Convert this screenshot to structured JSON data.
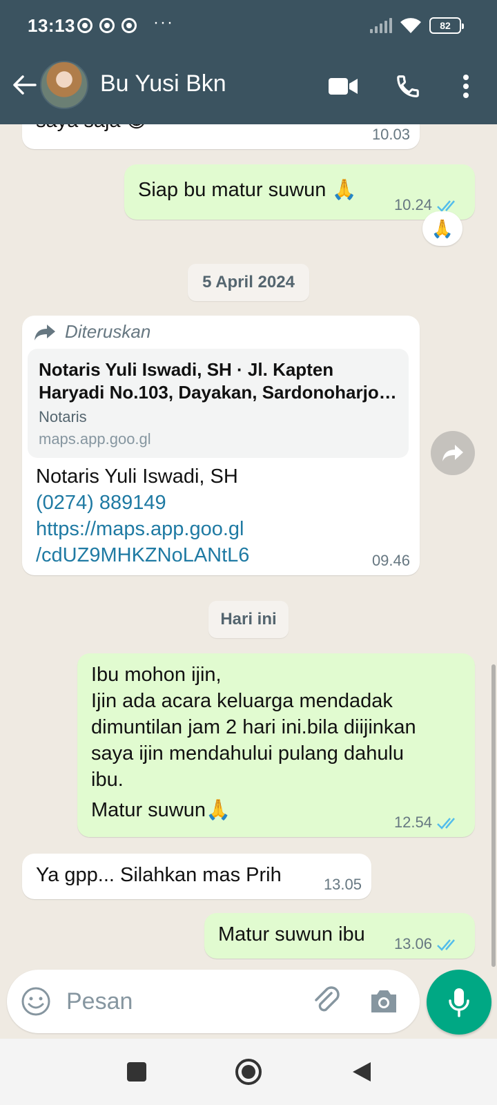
{
  "status": {
    "time": "13:13",
    "ellipsis": "···",
    "battery": "82"
  },
  "header": {
    "contact_name": "Bu Yusi Bkn"
  },
  "messages": {
    "m1": {
      "text": "saya saja 😁",
      "time": "10.03"
    },
    "m2": {
      "text": "Siap bu matur suwun 🙏",
      "time": "10.24",
      "reaction": "🙏"
    },
    "date1": "5 April 2024",
    "m3": {
      "forwarded_label": "Diteruskan",
      "link_title_1": "Notaris Yuli Iswadi, SH · Jl. Kapten",
      "link_title_2": "Haryadi No.103, Dayakan, Sardonoharjo,…",
      "link_category": "Notaris",
      "link_domain": "maps.app.goo.gl",
      "line1": "Notaris Yuli Iswadi, SH",
      "phone": "(0274) 889149",
      "url_1": "https://maps.app.goo.gl",
      "url_2": "/cdUZ9MHKZNoLANtL6",
      "time": "09.46"
    },
    "date2": "Hari ini",
    "m4": {
      "line1": "Ibu mohon ijin,",
      "line2": "Ijin ada acara keluarga mendadak",
      "line3": "dimuntilan jam 2 hari ini.bila diijinkan",
      "line4": "saya ijin mendahului pulang dahulu",
      "line5": "ibu.",
      "line6": "Matur suwun🙏",
      "time": "12.54"
    },
    "m5": {
      "text": "Ya gpp... Silahkan mas Prih",
      "time": "13.05"
    },
    "m6": {
      "text": "Matur suwun ibu",
      "time": "13.06"
    }
  },
  "input": {
    "placeholder": "Pesan"
  },
  "colors": {
    "header": "#3b5360",
    "outgoing": "#e1fbd0",
    "incoming": "#ffffff",
    "accent": "#00a884",
    "read_ticks": "#53bdeb",
    "link": "#1f7aa3"
  },
  "icons": [
    "back-arrow-icon",
    "video-call-icon",
    "phone-icon",
    "more-vert-icon",
    "forward-icon",
    "share-icon",
    "emoji-icon",
    "attach-icon",
    "camera-icon",
    "mic-icon",
    "recents-icon",
    "home-icon",
    "back-icon"
  ]
}
